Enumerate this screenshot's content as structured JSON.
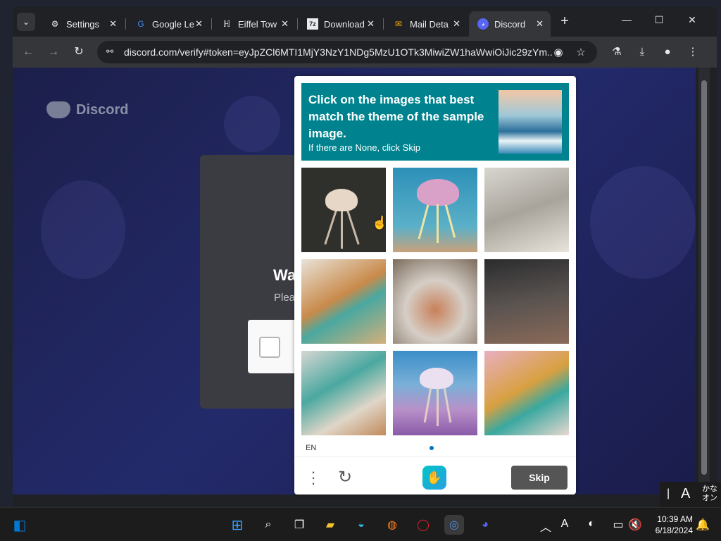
{
  "browser": {
    "tabs": [
      {
        "label": "Settings",
        "icon": "gear-icon",
        "active": false
      },
      {
        "label": "Google Le",
        "icon": "google-lens-icon",
        "active": false
      },
      {
        "label": "Eiffel Tow",
        "icon": "eiffel-site-icon",
        "active": false
      },
      {
        "label": "Download",
        "icon": "download-site-icon",
        "active": false
      },
      {
        "label": "Mail Deta",
        "icon": "mail-icon",
        "active": false
      },
      {
        "label": "Discord",
        "icon": "discord-icon",
        "active": true
      }
    ],
    "url": "discord.com/verify#token=eyJpZCl6MTI1MjY3NzY1NDg5MzU1OTk3MiwiZW1haWwiOiJic29zYm..."
  },
  "page": {
    "brand": "Discord",
    "card_title": "Wa",
    "card_subtitle": "Plea"
  },
  "captcha": {
    "prompt_title": "Click on the images that best match the theme of the sample image.",
    "prompt_hint": "If there are None, click Skip",
    "grid": [
      "jellyfish-dark",
      "jellyfish-pink",
      "kitchen-white",
      "kitchen-colorful",
      "food-platter",
      "kitchen-dark",
      "kitchen-isometric",
      "jellyfish-purple",
      "kitchen-pink"
    ],
    "language": "EN",
    "skip_label": "Skip",
    "accent": "#00838f"
  },
  "taskbar": {
    "time": "10:39 AM",
    "date": "6/18/2024",
    "ime_label": "A",
    "ime_kana": "かな\nオン"
  }
}
